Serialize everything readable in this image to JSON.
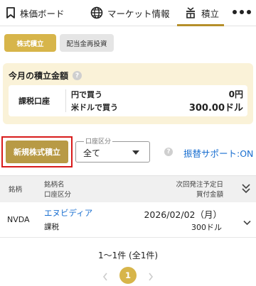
{
  "nav": {
    "items": [
      {
        "label": "株価ボード",
        "icon": "bookmark-icon"
      },
      {
        "label": "マーケット情報",
        "icon": "globe-icon"
      },
      {
        "label": "積立",
        "icon": "savings-pot-icon"
      }
    ],
    "active_index": 2,
    "more_icon": "more-dots-icon"
  },
  "subtabs": [
    {
      "label": "株式積立",
      "active": true
    },
    {
      "label": "配当金再投資",
      "active": false
    }
  ],
  "monthly": {
    "title": "今月の積立金額",
    "help_icon": "?",
    "account_type": "課税口座",
    "rows": [
      {
        "label": "円で買う",
        "value": "0円"
      },
      {
        "label": "米ドルで買う",
        "value": "300.00ドル"
      }
    ]
  },
  "actions": {
    "new_button": "新規株式積立",
    "account_select_label": "口座区分",
    "account_select_value": "全て",
    "help_icon": "?",
    "transfer_link": "振替サポート:ON"
  },
  "table": {
    "headers": {
      "ticker": "銘柄",
      "name": "銘柄名",
      "account": "口座区分",
      "next_date": "次回発注予定日",
      "amount": "買付金額"
    },
    "rows": [
      {
        "ticker": "NVDA",
        "name": "エヌビディア",
        "account": "課税",
        "next_date": "2026/02/02（月）",
        "amount": "300ドル"
      }
    ]
  },
  "pagination": {
    "summary": "1～1件 (全1件)",
    "current": "1"
  },
  "colors": {
    "accent_gold": "#d7b54a",
    "button_gold": "#b89a45",
    "card_bg": "#faf2d8",
    "link_blue": "#1a6fd0",
    "highlight_red": "#d81b1b"
  }
}
